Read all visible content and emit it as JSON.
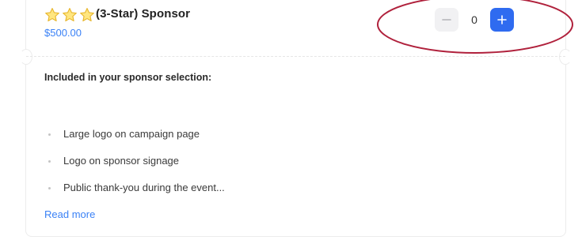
{
  "tier": {
    "star_count": 3,
    "star_icon": "star-icon",
    "title": "(3-Star) Sponsor",
    "price": "$500.00"
  },
  "stepper": {
    "quantity": "0",
    "minus_icon": "minus-icon",
    "plus_icon": "plus-icon"
  },
  "included": {
    "heading": "Included in your sponsor selection:",
    "items": [
      "Large logo on campaign page",
      "Logo on sponsor signage",
      "Public thank-you during the event..."
    ],
    "read_more": "Read more"
  },
  "colors": {
    "accent": "#2f6bf0",
    "price_link": "#3b82f6",
    "star_fill": "#ffe680",
    "star_stroke": "#e7b52a",
    "highlight_ellipse": "#b0213c"
  }
}
